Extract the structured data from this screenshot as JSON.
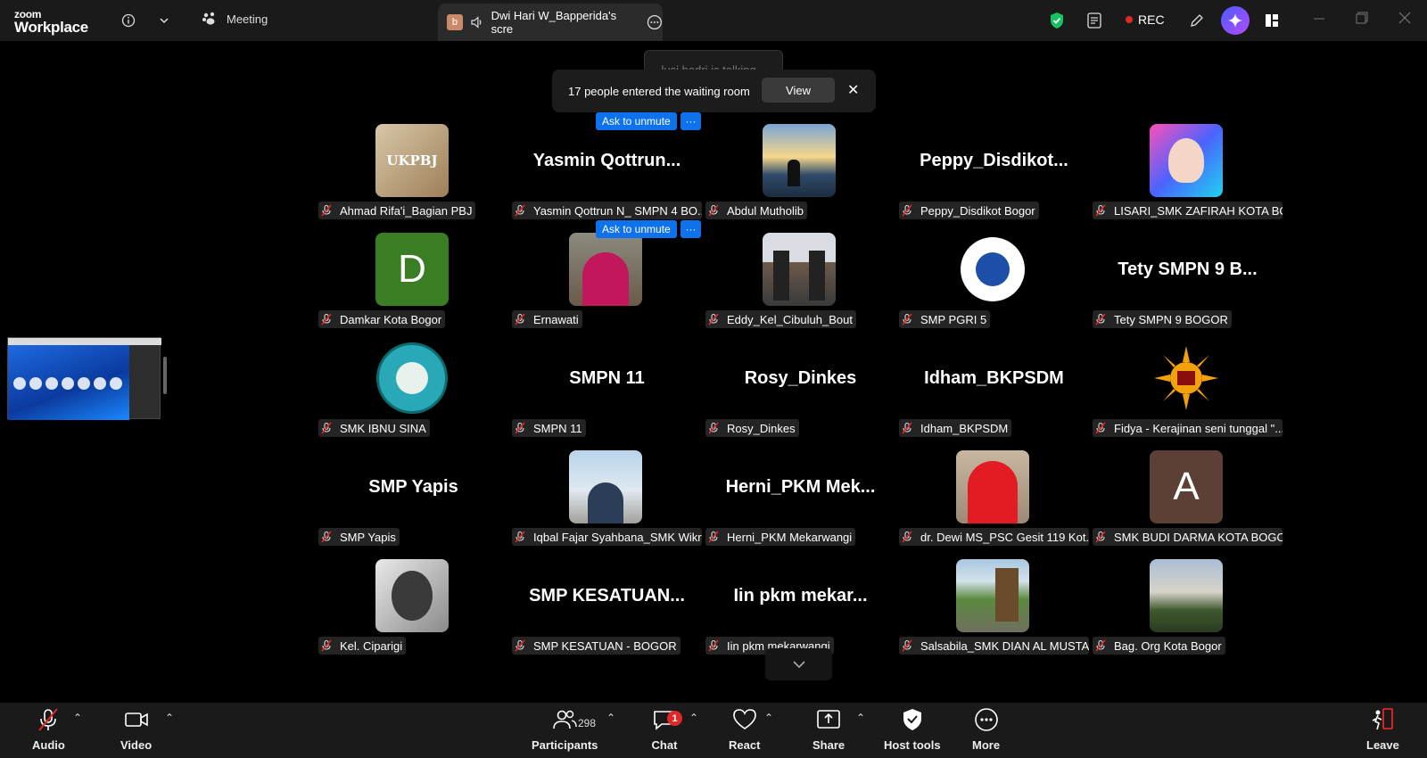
{
  "app": {
    "logo_line1": "zoom",
    "logo_line2": "Workplace"
  },
  "header": {
    "meeting_tab": "Meeting",
    "share_tab_avatar": "b",
    "share_tab_label": "Dwi Hari W_Bapperida's scre",
    "rec_label": "REC"
  },
  "notifications": {
    "talking": "lusi badri is talking...",
    "waiting_text": "17 people entered the waiting room",
    "view_label": "View",
    "close_label": "✕"
  },
  "ask_unmute": {
    "label": "Ask to unmute",
    "more": "···"
  },
  "participants": [
    {
      "name": "Ahmad Rifa'i_Bagian PBJ",
      "display": "",
      "avatar": "photo-ukpbj"
    },
    {
      "name": "Yasmin Qottrun N_ SMPN 4 BO...",
      "display": "Yasmin  Qottrun...",
      "avatar": ""
    },
    {
      "name": "Abdul Mutholib",
      "display": "",
      "avatar": "photo-sunset"
    },
    {
      "name": "Peppy_Disdikot Bogor",
      "display": "Peppy_Disdikot...",
      "avatar": ""
    },
    {
      "name": "LISARI_SMK ZAFIRAH KOTA BO...",
      "display": "",
      "avatar": "photo-lisari"
    },
    {
      "name": "Damkar Kota Bogor",
      "display": "",
      "avatar": "letter",
      "letter": "D",
      "color": "#3a7d23"
    },
    {
      "name": "Ernawati",
      "display": "",
      "avatar": "photo-woman"
    },
    {
      "name": "Eddy_Kel_Cibuluh_Bout",
      "display": "",
      "avatar": "photo-building"
    },
    {
      "name": "SMP PGRI 5",
      "display": "",
      "avatar": "logo-primabo"
    },
    {
      "name": "Tety SMPN 9 BOGOR",
      "display": "Tety  SMPN  9  B...",
      "avatar": ""
    },
    {
      "name": "SMK IBNU SINA",
      "display": "",
      "avatar": "logo-ibnusina"
    },
    {
      "name": "SMPN 11",
      "display": "SMPN 11",
      "avatar": ""
    },
    {
      "name": "Rosy_Dinkes",
      "display": "Rosy_Dinkes",
      "avatar": ""
    },
    {
      "name": "Idham_BKPSDM",
      "display": "Idham_BKPSDM",
      "avatar": ""
    },
    {
      "name": "Fidya - Kerajinan seni tunggal \"...",
      "display": "",
      "avatar": "logo-sun"
    },
    {
      "name": "SMP Yapis",
      "display": "SMP Yapis",
      "avatar": ""
    },
    {
      "name": "Iqbal Fajar Syahbana_SMK Wikr...",
      "display": "",
      "avatar": "photo-man"
    },
    {
      "name": "Herni_PKM Mekarwangi",
      "display": "Herni_PKM  Mek...",
      "avatar": ""
    },
    {
      "name": "dr. Dewi MS_PSC Gesit 119 Kot...",
      "display": "",
      "avatar": "photo-hijab-red"
    },
    {
      "name": "SMK BUDI DARMA KOTA BOGOR",
      "display": "",
      "avatar": "letter",
      "letter": "A",
      "color": "#5c3f35"
    },
    {
      "name": "Kel. Ciparigi",
      "display": "",
      "avatar": "photo-bw"
    },
    {
      "name": "SMP KESATUAN - BOGOR",
      "display": "SMP  KESATUAN...",
      "avatar": ""
    },
    {
      "name": "Iin pkm mekarwangi",
      "display": "Iin  pkm  mekar...",
      "avatar": ""
    },
    {
      "name": "Salsabila_SMK DIAN AL MUSTA...",
      "display": "",
      "avatar": "photo-park"
    },
    {
      "name": "Bag. Org Kota Bogor",
      "display": "",
      "avatar": "photo-hill"
    }
  ],
  "toolbar": {
    "audio": "Audio",
    "video": "Video",
    "participants": "Participants",
    "participants_count": "298",
    "chat": "Chat",
    "chat_badge": "1",
    "react": "React",
    "share": "Share",
    "host_tools": "Host tools",
    "more": "More",
    "leave": "Leave"
  },
  "colors": {
    "unmute_blue": "#0e72ed",
    "rec_red": "#e02828",
    "shield_green": "#19c165"
  }
}
